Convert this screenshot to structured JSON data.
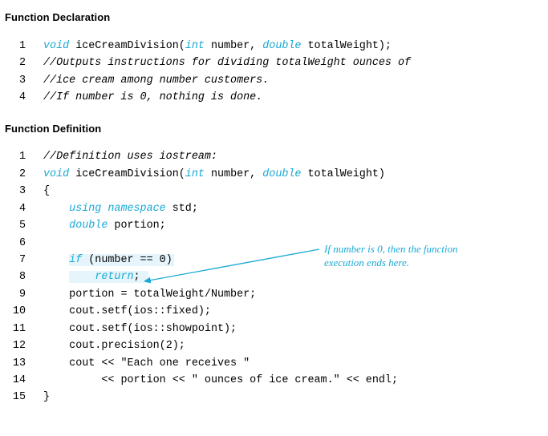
{
  "heading1": "Function Declaration",
  "heading2": "Function Definition",
  "decl": {
    "1": {
      "kw_void": "void",
      "fn": " iceCreamDivision(",
      "kw_int": "int",
      "p1": " number, ",
      "kw_dbl": "double",
      "p2": " totalWeight);"
    },
    "2": "//Outputs instructions for dividing totalWeight ounces of",
    "3": "//ice cream among number customers.",
    "4": "//If number is 0, nothing is done."
  },
  "def": {
    "1": "//Definition uses iostream:",
    "2": {
      "kw_void": "void",
      "fn": " iceCreamDivision(",
      "kw_int": "int",
      "p1": " number, ",
      "kw_dbl": "double",
      "p2": " totalWeight)"
    },
    "3": "{",
    "4": {
      "kw": "using namespace",
      "rest": " std;"
    },
    "5": {
      "kw": "double",
      "rest": " portion;"
    },
    "6": "",
    "7": {
      "kw": "if",
      "rest": " (number == 0)"
    },
    "8": {
      "kw": "return",
      "rest": ";"
    },
    "9": "portion = totalWeight/Number;",
    "10": "cout.setf(ios::fixed);",
    "11": "cout.setf(ios::showpoint);",
    "12": "cout.precision(2);",
    "13": "cout << \"Each one receives \"",
    "14": "     << portion << \" ounces of ice cream.\" << endl;",
    "15": "}"
  },
  "annotation": "If number is 0, then the function execution ends here."
}
